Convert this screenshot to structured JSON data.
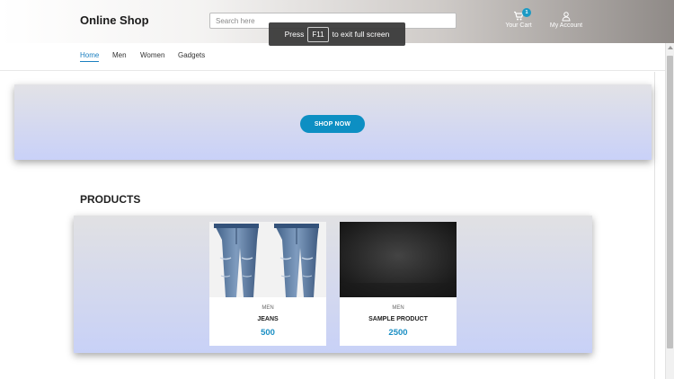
{
  "header": {
    "logo": "Online Shop",
    "search_placeholder": "Search here",
    "cart_label": "Your Cart",
    "cart_count": "1",
    "account_label": "My Account"
  },
  "fullscreen_notice": {
    "prefix": "Press",
    "key": "F11",
    "suffix": "to exit full screen"
  },
  "nav": {
    "items": [
      "Home",
      "Men",
      "Women",
      "Gadgets"
    ],
    "active": "Home"
  },
  "hero": {
    "button_label": "SHOP NOW"
  },
  "products": {
    "title": "PRODUCTS",
    "items": [
      {
        "category": "MEN",
        "name": "JEANS",
        "price": "500"
      },
      {
        "category": "MEN",
        "name": "SAMPLE PRODUCT",
        "price": "2500"
      }
    ]
  },
  "colors": {
    "accent": "#1b8fc4",
    "button": "#0d8fc3",
    "nav_active": "#1b7fc0"
  }
}
